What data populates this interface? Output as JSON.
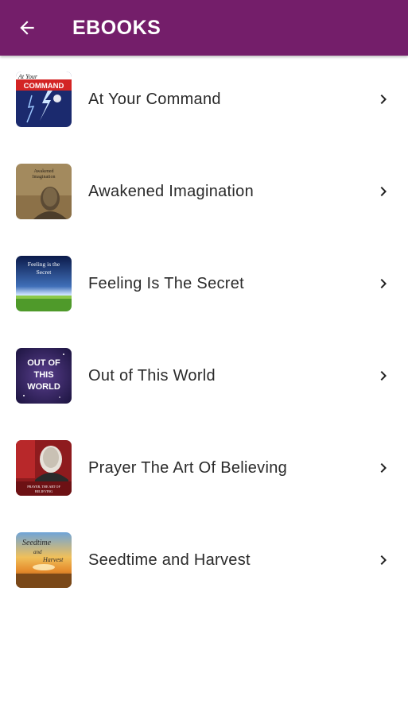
{
  "appbar": {
    "title": "EBOOKS",
    "back_icon": "arrow-left-icon",
    "color": "#741e6a"
  },
  "books": [
    {
      "title": "At Your Command",
      "cover_text": [
        "At Your",
        "COMMAND"
      ],
      "cover_icon": "lightning-cover"
    },
    {
      "title": "Awakened Imagination",
      "cover_text": [
        "Awakened",
        "Imagination"
      ],
      "cover_icon": "portrait-cover"
    },
    {
      "title": "Feeling Is The Secret",
      "cover_text": [
        "Feeling is the",
        "Secret"
      ],
      "cover_icon": "field-cover"
    },
    {
      "title": "Out of This World",
      "cover_text": [
        "OUT OF",
        "THIS",
        "WORLD"
      ],
      "cover_icon": "space-cover"
    },
    {
      "title": "Prayer The Art Of Believing",
      "cover_text": [
        "PRAYER, THE ART OF",
        "BELIEVING"
      ],
      "cover_icon": "portrait-red-cover"
    },
    {
      "title": "Seedtime and Harvest",
      "cover_text": [
        "Seedtime",
        "and",
        "Harvest"
      ],
      "cover_icon": "sunset-cover"
    }
  ],
  "chevron_icon": "chevron-right-icon"
}
